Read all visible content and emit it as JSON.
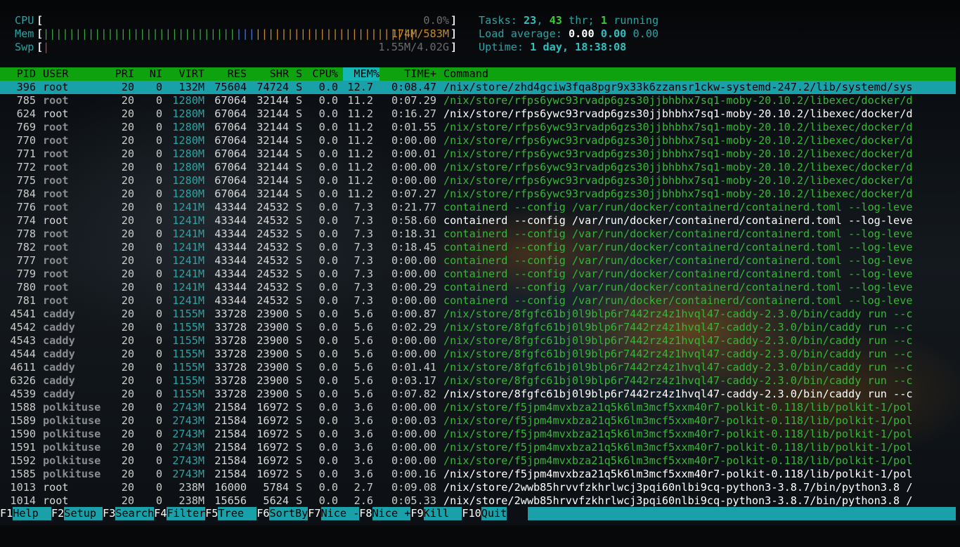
{
  "meters": {
    "cpu": {
      "label": "CPU",
      "value": "0.0%"
    },
    "mem": {
      "label": "Mem",
      "value": "174M/583M"
    },
    "swp": {
      "label": "Swp",
      "value": "1.55M/4.02G"
    }
  },
  "stats": {
    "tasks_label": "Tasks: ",
    "tasks": "23",
    "thr": "43",
    "thr_label": " thr; ",
    "running": "1",
    "running_label": " running",
    "load_label": "Load average: ",
    "load1": "0.00",
    "load5": "0.00",
    "load15": "0.00",
    "uptime_label": "Uptime: ",
    "uptime": "1 day, 18:38:08"
  },
  "columns": [
    "PID",
    "USER",
    "PRI",
    "NI",
    "VIRT",
    "RES",
    "SHR",
    "S",
    "CPU%",
    "MEM%",
    "TIME+",
    "Command"
  ],
  "processes": [
    {
      "pid": "396",
      "user": "root",
      "pri": "20",
      "ni": "0",
      "virt": "132M",
      "res": "75604",
      "shr": "74724",
      "s": "S",
      "cpu": "0.0",
      "mem": "12.7",
      "time": "0:08.47",
      "cmd": "/nix/store/zhd4gciw3fqa8pgr9x33k6zzansr1ckw-systemd-247.2/lib/systemd/sys",
      "selected": true
    },
    {
      "pid": "785",
      "user": "root",
      "pri": "20",
      "ni": "0",
      "virt": "1280M",
      "res": "67064",
      "shr": "32144",
      "s": "S",
      "cpu": "0.0",
      "mem": "11.2",
      "time": "0:07.29",
      "cmd": "/nix/store/rfps6ywc93rvadp6gzs30jjbhbhx7sq1-moby-20.10.2/libexec/docker/d",
      "thread": true
    },
    {
      "pid": "624",
      "user": "root",
      "pri": "20",
      "ni": "0",
      "virt": "1280M",
      "res": "67064",
      "shr": "32144",
      "s": "S",
      "cpu": "0.0",
      "mem": "11.2",
      "time": "0:16.27",
      "cmd": "/nix/store/rfps6ywc93rvadp6gzs30jjbhbhx7sq1-moby-20.10.2/libexec/docker/d",
      "thread": false
    },
    {
      "pid": "769",
      "user": "root",
      "pri": "20",
      "ni": "0",
      "virt": "1280M",
      "res": "67064",
      "shr": "32144",
      "s": "S",
      "cpu": "0.0",
      "mem": "11.2",
      "time": "0:01.55",
      "cmd": "/nix/store/rfps6ywc93rvadp6gzs30jjbhbhx7sq1-moby-20.10.2/libexec/docker/d",
      "thread": true
    },
    {
      "pid": "770",
      "user": "root",
      "pri": "20",
      "ni": "0",
      "virt": "1280M",
      "res": "67064",
      "shr": "32144",
      "s": "S",
      "cpu": "0.0",
      "mem": "11.2",
      "time": "0:00.00",
      "cmd": "/nix/store/rfps6ywc93rvadp6gzs30jjbhbhx7sq1-moby-20.10.2/libexec/docker/d",
      "thread": true
    },
    {
      "pid": "771",
      "user": "root",
      "pri": "20",
      "ni": "0",
      "virt": "1280M",
      "res": "67064",
      "shr": "32144",
      "s": "S",
      "cpu": "0.0",
      "mem": "11.2",
      "time": "0:00.01",
      "cmd": "/nix/store/rfps6ywc93rvadp6gzs30jjbhbhx7sq1-moby-20.10.2/libexec/docker/d",
      "thread": true
    },
    {
      "pid": "772",
      "user": "root",
      "pri": "20",
      "ni": "0",
      "virt": "1280M",
      "res": "67064",
      "shr": "32144",
      "s": "S",
      "cpu": "0.0",
      "mem": "11.2",
      "time": "0:00.00",
      "cmd": "/nix/store/rfps6ywc93rvadp6gzs30jjbhbhx7sq1-moby-20.10.2/libexec/docker/d",
      "thread": true
    },
    {
      "pid": "775",
      "user": "root",
      "pri": "20",
      "ni": "0",
      "virt": "1280M",
      "res": "67064",
      "shr": "32144",
      "s": "S",
      "cpu": "0.0",
      "mem": "11.2",
      "time": "0:00.00",
      "cmd": "/nix/store/rfps6ywc93rvadp6gzs30jjbhbhx7sq1-moby-20.10.2/libexec/docker/d",
      "thread": true
    },
    {
      "pid": "784",
      "user": "root",
      "pri": "20",
      "ni": "0",
      "virt": "1280M",
      "res": "67064",
      "shr": "32144",
      "s": "S",
      "cpu": "0.0",
      "mem": "11.2",
      "time": "0:07.27",
      "cmd": "/nix/store/rfps6ywc93rvadp6gzs30jjbhbhx7sq1-moby-20.10.2/libexec/docker/d",
      "thread": true
    },
    {
      "pid": "776",
      "user": "root",
      "pri": "20",
      "ni": "0",
      "virt": "1241M",
      "res": "43344",
      "shr": "24532",
      "s": "S",
      "cpu": "0.0",
      "mem": "7.3",
      "time": "0:21.77",
      "cmd": "containerd --config /var/run/docker/containerd/containerd.toml --log-leve",
      "thread": true
    },
    {
      "pid": "774",
      "user": "root",
      "pri": "20",
      "ni": "0",
      "virt": "1241M",
      "res": "43344",
      "shr": "24532",
      "s": "S",
      "cpu": "0.0",
      "mem": "7.3",
      "time": "0:58.60",
      "cmd": "containerd --config /var/run/docker/containerd/containerd.toml --log-leve",
      "thread": false
    },
    {
      "pid": "778",
      "user": "root",
      "pri": "20",
      "ni": "0",
      "virt": "1241M",
      "res": "43344",
      "shr": "24532",
      "s": "S",
      "cpu": "0.0",
      "mem": "7.3",
      "time": "0:18.31",
      "cmd": "containerd --config /var/run/docker/containerd/containerd.toml --log-leve",
      "thread": true
    },
    {
      "pid": "782",
      "user": "root",
      "pri": "20",
      "ni": "0",
      "virt": "1241M",
      "res": "43344",
      "shr": "24532",
      "s": "S",
      "cpu": "0.0",
      "mem": "7.3",
      "time": "0:18.45",
      "cmd": "containerd --config /var/run/docker/containerd/containerd.toml --log-leve",
      "thread": true
    },
    {
      "pid": "777",
      "user": "root",
      "pri": "20",
      "ni": "0",
      "virt": "1241M",
      "res": "43344",
      "shr": "24532",
      "s": "S",
      "cpu": "0.0",
      "mem": "7.3",
      "time": "0:00.00",
      "cmd": "containerd --config /var/run/docker/containerd/containerd.toml --log-leve",
      "thread": true
    },
    {
      "pid": "779",
      "user": "root",
      "pri": "20",
      "ni": "0",
      "virt": "1241M",
      "res": "43344",
      "shr": "24532",
      "s": "S",
      "cpu": "0.0",
      "mem": "7.3",
      "time": "0:00.00",
      "cmd": "containerd --config /var/run/docker/containerd/containerd.toml --log-leve",
      "thread": true
    },
    {
      "pid": "780",
      "user": "root",
      "pri": "20",
      "ni": "0",
      "virt": "1241M",
      "res": "43344",
      "shr": "24532",
      "s": "S",
      "cpu": "0.0",
      "mem": "7.3",
      "time": "0:00.29",
      "cmd": "containerd --config /var/run/docker/containerd/containerd.toml --log-leve",
      "thread": true
    },
    {
      "pid": "781",
      "user": "root",
      "pri": "20",
      "ni": "0",
      "virt": "1241M",
      "res": "43344",
      "shr": "24532",
      "s": "S",
      "cpu": "0.0",
      "mem": "7.3",
      "time": "0:00.00",
      "cmd": "containerd --config /var/run/docker/containerd/containerd.toml --log-leve",
      "thread": true
    },
    {
      "pid": "4541",
      "user": "caddy",
      "pri": "20",
      "ni": "0",
      "virt": "1155M",
      "res": "33728",
      "shr": "23900",
      "s": "S",
      "cpu": "0.0",
      "mem": "5.6",
      "time": "0:00.87",
      "cmd": "/nix/store/8fgfc61bj0l9blp6r7442rz4z1hvql47-caddy-2.3.0/bin/caddy run --c",
      "thread": true
    },
    {
      "pid": "4542",
      "user": "caddy",
      "pri": "20",
      "ni": "0",
      "virt": "1155M",
      "res": "33728",
      "shr": "23900",
      "s": "S",
      "cpu": "0.0",
      "mem": "5.6",
      "time": "0:02.29",
      "cmd": "/nix/store/8fgfc61bj0l9blp6r7442rz4z1hvql47-caddy-2.3.0/bin/caddy run --c",
      "thread": true
    },
    {
      "pid": "4543",
      "user": "caddy",
      "pri": "20",
      "ni": "0",
      "virt": "1155M",
      "res": "33728",
      "shr": "23900",
      "s": "S",
      "cpu": "0.0",
      "mem": "5.6",
      "time": "0:00.00",
      "cmd": "/nix/store/8fgfc61bj0l9blp6r7442rz4z1hvql47-caddy-2.3.0/bin/caddy run --c",
      "thread": true
    },
    {
      "pid": "4544",
      "user": "caddy",
      "pri": "20",
      "ni": "0",
      "virt": "1155M",
      "res": "33728",
      "shr": "23900",
      "s": "S",
      "cpu": "0.0",
      "mem": "5.6",
      "time": "0:00.00",
      "cmd": "/nix/store/8fgfc61bj0l9blp6r7442rz4z1hvql47-caddy-2.3.0/bin/caddy run --c",
      "thread": true
    },
    {
      "pid": "4611",
      "user": "caddy",
      "pri": "20",
      "ni": "0",
      "virt": "1155M",
      "res": "33728",
      "shr": "23900",
      "s": "S",
      "cpu": "0.0",
      "mem": "5.6",
      "time": "0:01.41",
      "cmd": "/nix/store/8fgfc61bj0l9blp6r7442rz4z1hvql47-caddy-2.3.0/bin/caddy run --c",
      "thread": true
    },
    {
      "pid": "6326",
      "user": "caddy",
      "pri": "20",
      "ni": "0",
      "virt": "1155M",
      "res": "33728",
      "shr": "23900",
      "s": "S",
      "cpu": "0.0",
      "mem": "5.6",
      "time": "0:03.17",
      "cmd": "/nix/store/8fgfc61bj0l9blp6r7442rz4z1hvql47-caddy-2.3.0/bin/caddy run --c",
      "thread": true
    },
    {
      "pid": "4539",
      "user": "caddy",
      "pri": "20",
      "ni": "0",
      "virt": "1155M",
      "res": "33728",
      "shr": "23900",
      "s": "S",
      "cpu": "0.0",
      "mem": "5.6",
      "time": "0:07.82",
      "cmd": "/nix/store/8fgfc61bj0l9blp6r7442rz4z1hvql47-caddy-2.3.0/bin/caddy run --c",
      "thread": false
    },
    {
      "pid": "1588",
      "user": "polkituse",
      "pri": "20",
      "ni": "0",
      "virt": "2743M",
      "res": "21584",
      "shr": "16972",
      "s": "S",
      "cpu": "0.0",
      "mem": "3.6",
      "time": "0:00.00",
      "cmd": "/nix/store/f5jpm4mvxbza21q5k6lm3mcf5xxm40r7-polkit-0.118/lib/polkit-1/pol",
      "thread": true
    },
    {
      "pid": "1589",
      "user": "polkituse",
      "pri": "20",
      "ni": "0",
      "virt": "2743M",
      "res": "21584",
      "shr": "16972",
      "s": "S",
      "cpu": "0.0",
      "mem": "3.6",
      "time": "0:00.03",
      "cmd": "/nix/store/f5jpm4mvxbza21q5k6lm3mcf5xxm40r7-polkit-0.118/lib/polkit-1/pol",
      "thread": true
    },
    {
      "pid": "1590",
      "user": "polkituse",
      "pri": "20",
      "ni": "0",
      "virt": "2743M",
      "res": "21584",
      "shr": "16972",
      "s": "S",
      "cpu": "0.0",
      "mem": "3.6",
      "time": "0:00.00",
      "cmd": "/nix/store/f5jpm4mvxbza21q5k6lm3mcf5xxm40r7-polkit-0.118/lib/polkit-1/pol",
      "thread": true
    },
    {
      "pid": "1591",
      "user": "polkituse",
      "pri": "20",
      "ni": "0",
      "virt": "2743M",
      "res": "21584",
      "shr": "16972",
      "s": "S",
      "cpu": "0.0",
      "mem": "3.6",
      "time": "0:00.00",
      "cmd": "/nix/store/f5jpm4mvxbza21q5k6lm3mcf5xxm40r7-polkit-0.118/lib/polkit-1/pol",
      "thread": true
    },
    {
      "pid": "1592",
      "user": "polkituse",
      "pri": "20",
      "ni": "0",
      "virt": "2743M",
      "res": "21584",
      "shr": "16972",
      "s": "S",
      "cpu": "0.0",
      "mem": "3.6",
      "time": "0:00.00",
      "cmd": "/nix/store/f5jpm4mvxbza21q5k6lm3mcf5xxm40r7-polkit-0.118/lib/polkit-1/pol",
      "thread": true
    },
    {
      "pid": "1585",
      "user": "polkituse",
      "pri": "20",
      "ni": "0",
      "virt": "2743M",
      "res": "21584",
      "shr": "16972",
      "s": "S",
      "cpu": "0.0",
      "mem": "3.6",
      "time": "0:00.16",
      "cmd": "/nix/store/f5jpm4mvxbza21q5k6lm3mcf5xxm40r7-polkit-0.118/lib/polkit-1/pol",
      "thread": false
    },
    {
      "pid": "1013",
      "user": "root",
      "pri": "20",
      "ni": "0",
      "virt": "238M",
      "res": "16000",
      "shr": "5784",
      "s": "S",
      "cpu": "0.0",
      "mem": "2.7",
      "time": "0:09.08",
      "cmd": "/nix/store/2wwb85hrvvfzkhrlwcj3pqi60nlbi9cq-python3-3.8.7/bin/python3.8 /",
      "thread": false
    },
    {
      "pid": "1014",
      "user": "root",
      "pri": "20",
      "ni": "0",
      "virt": "238M",
      "res": "15656",
      "shr": "5624",
      "s": "S",
      "cpu": "0.0",
      "mem": "2.6",
      "time": "0:05.33",
      "cmd": "/nix/store/2wwb85hrvvfzkhrlwcj3pqi60nlbi9cq-python3-3.8.7/bin/python3.8 /",
      "thread": false
    }
  ],
  "footer": [
    {
      "key": "F1",
      "label": "Help  "
    },
    {
      "key": "F2",
      "label": "Setup "
    },
    {
      "key": "F3",
      "label": "Search"
    },
    {
      "key": "F4",
      "label": "Filter"
    },
    {
      "key": "F5",
      "label": "Tree  "
    },
    {
      "key": "F6",
      "label": "SortBy"
    },
    {
      "key": "F7",
      "label": "Nice -"
    },
    {
      "key": "F8",
      "label": "Nice +"
    },
    {
      "key": "F9",
      "label": "Kill  "
    },
    {
      "key": "F10",
      "label": "Quit"
    }
  ],
  "colors": {
    "header_bg": "#0fa20f",
    "selected_bg": "#19a0a8",
    "thread_cmd": "#37b637",
    "accent_teal": "#2aa3a3"
  }
}
